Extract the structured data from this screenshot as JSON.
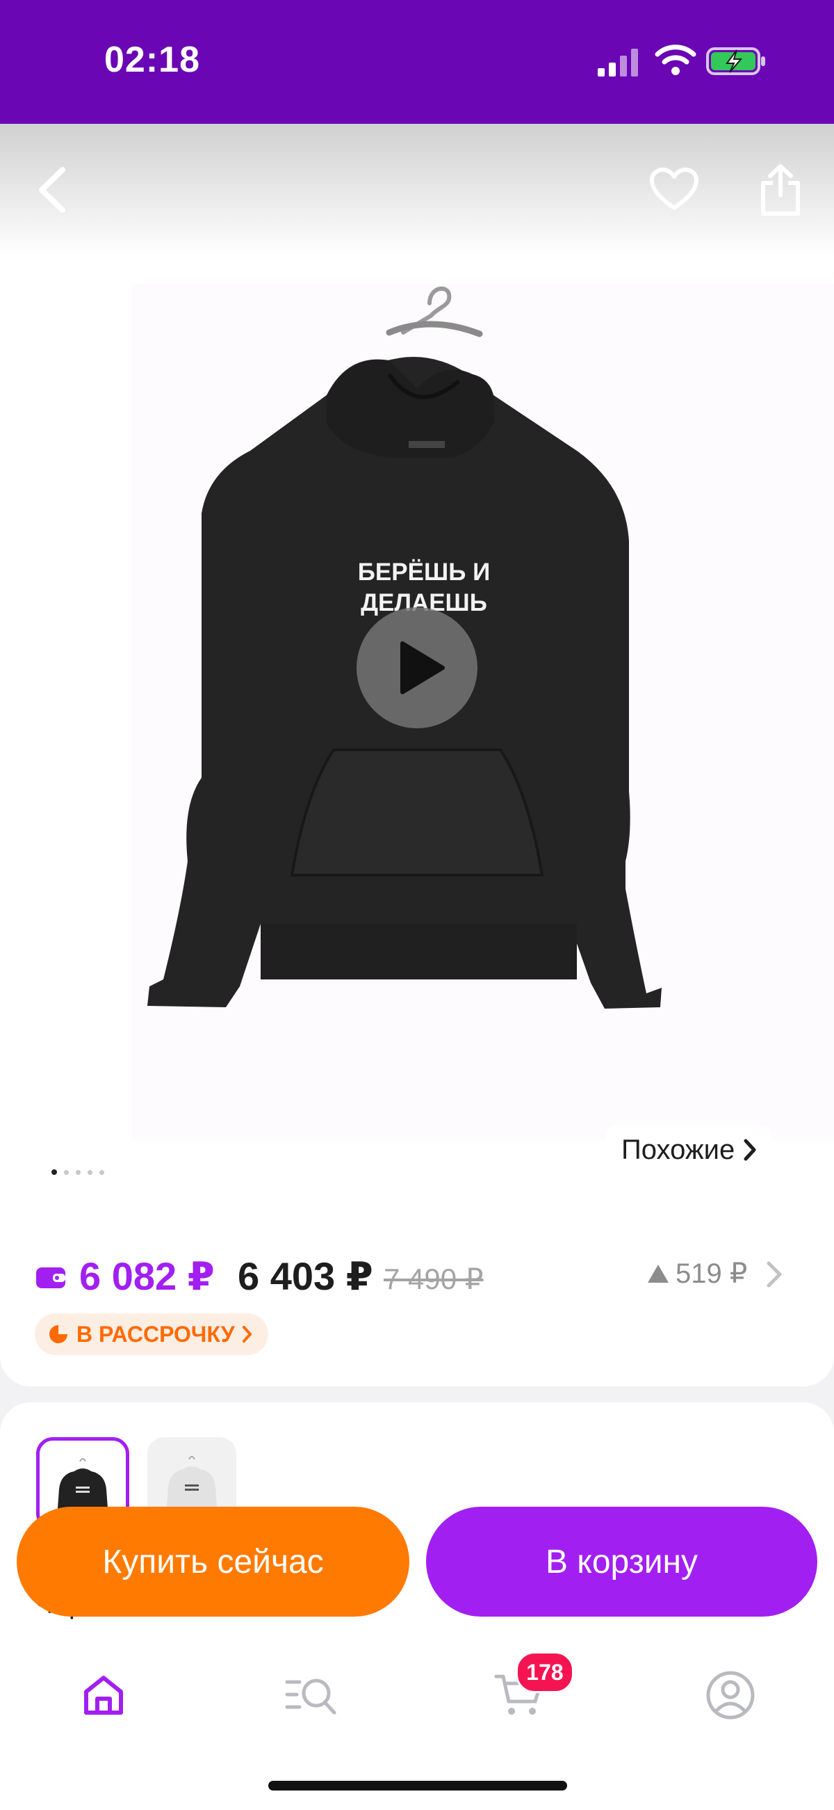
{
  "status_bar": {
    "time": "02:18"
  },
  "product_image": {
    "print_text": [
      "БЕРЁШЬ И",
      "ДЕЛАЕШЬ"
    ],
    "gallery_position": 1,
    "gallery_count": 5,
    "similar_label": "Похожие"
  },
  "pricing": {
    "wallet_price": "6 082 ₽",
    "price": "6 403 ₽",
    "old_price": "7 490 ₽",
    "price_change": "519 ₽",
    "installment_label": "В РАССРОЧКУ"
  },
  "variants": {
    "selected_color": "Черный",
    "options": [
      {
        "color": "Черный",
        "selected": true
      },
      {
        "color": "Белый",
        "selected": false
      }
    ]
  },
  "actions": {
    "buy_now": "Купить сейчас",
    "add_to_cart": "В корзину"
  },
  "tab_bar": {
    "cart_badge": "178"
  },
  "colors": {
    "brand_purple": "#6a06b4",
    "accent_purple": "#a21ff2",
    "accent_orange": "#ff7a00",
    "badge_red": "#f41452"
  }
}
